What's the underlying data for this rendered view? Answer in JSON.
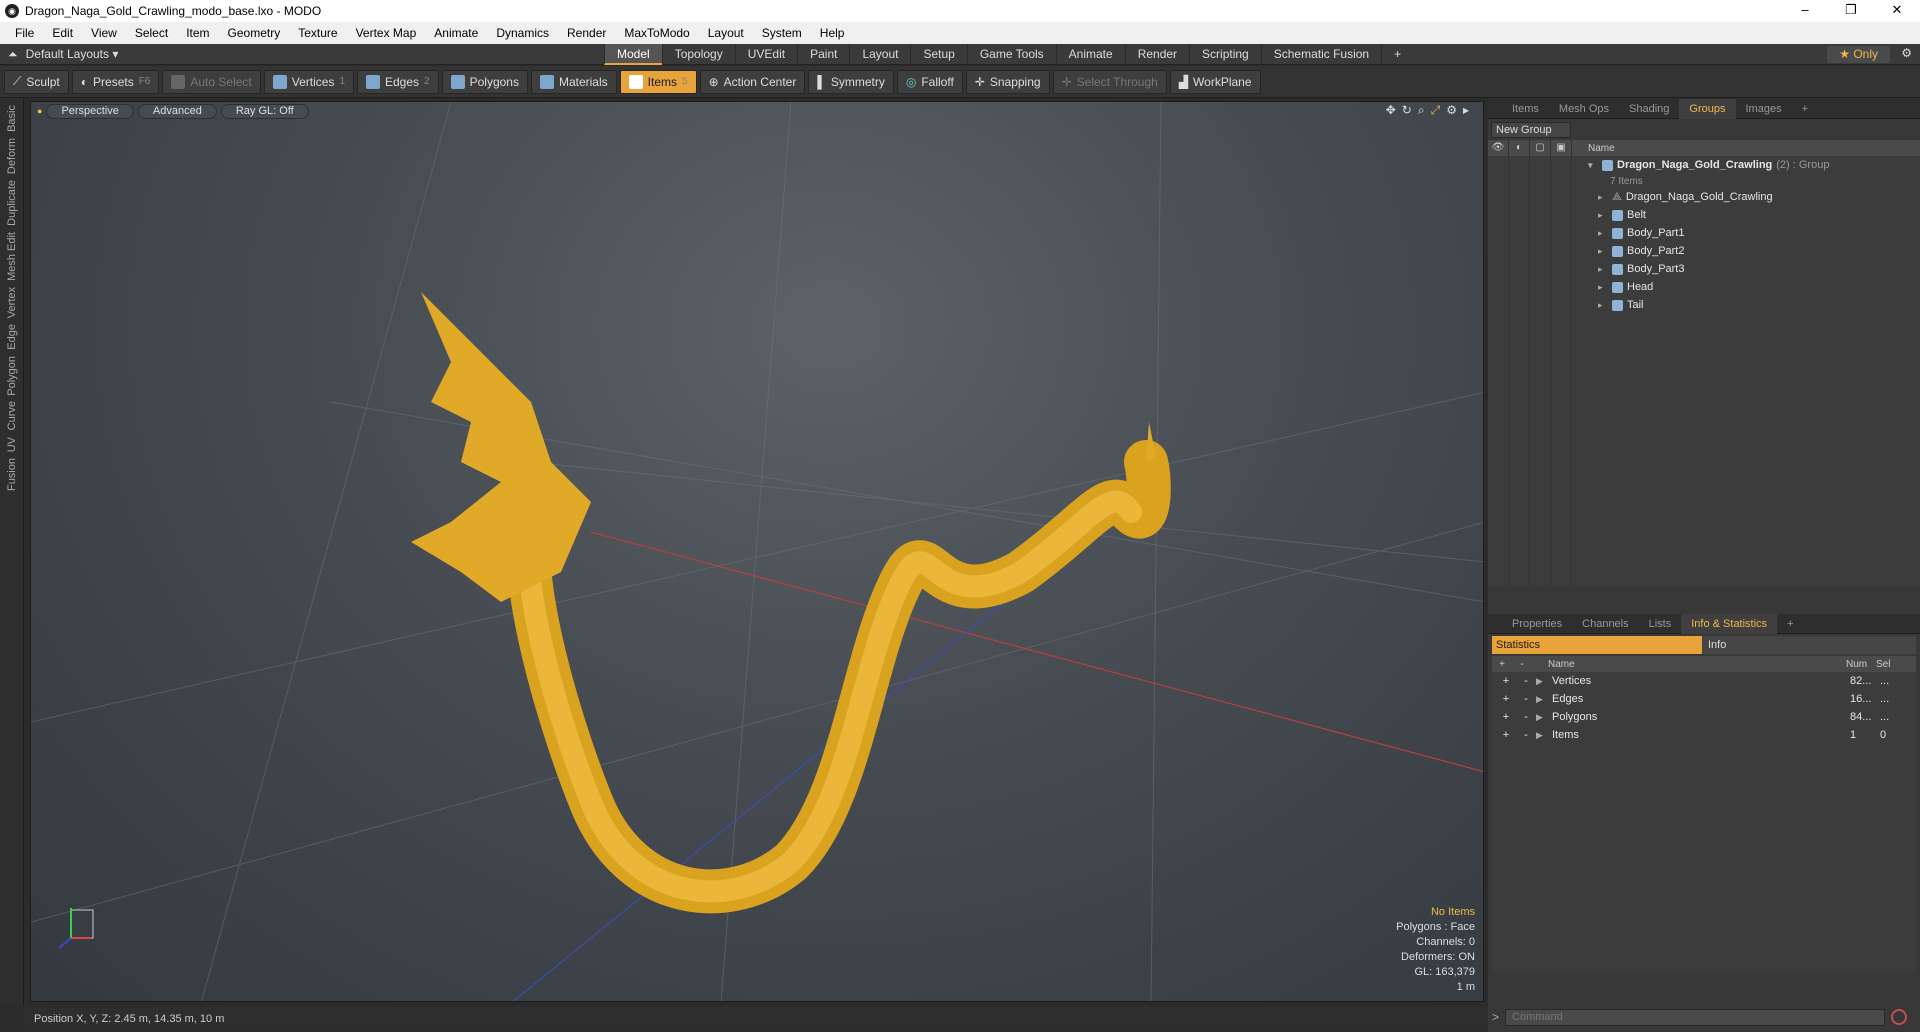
{
  "window": {
    "title": "Dragon_Naga_Gold_Crawling_modo_base.lxo - MODO",
    "min": "–",
    "max": "❐",
    "close": "✕"
  },
  "menu": [
    "File",
    "Edit",
    "View",
    "Select",
    "Item",
    "Geometry",
    "Texture",
    "Vertex Map",
    "Animate",
    "Dynamics",
    "Render",
    "MaxToModo",
    "Layout",
    "System",
    "Help"
  ],
  "layout": {
    "name": "Default Layouts",
    "tabs": [
      "Model",
      "Topology",
      "UVEdit",
      "Paint",
      "Layout",
      "Setup",
      "Game Tools",
      "Animate",
      "Render",
      "Scripting",
      "Schematic Fusion"
    ],
    "active_tab": "Model",
    "add": "+",
    "only": "Only"
  },
  "toolbar": {
    "sculpt": "Sculpt",
    "presets": "Presets",
    "presets_key": "F6",
    "auto_select": "Auto Select",
    "vertices": "Vertices",
    "vertices_key": "1",
    "edges": "Edges",
    "edges_key": "2",
    "polygons": "Polygons",
    "materials": "Materials",
    "items": "Items",
    "items_key": "5",
    "action_center": "Action Center",
    "symmetry": "Symmetry",
    "falloff": "Falloff",
    "snapping": "Snapping",
    "select_through": "Select Through",
    "workplane": "WorkPlane"
  },
  "left_strip": [
    "Basic",
    "Deform",
    "Duplicate",
    "Mesh Edit",
    "Vertex",
    "Edge",
    "Polygon",
    "Curve",
    "UV",
    "Fusion"
  ],
  "viewport": {
    "view": "Perspective",
    "mode": "Advanced",
    "raygl": "Ray GL: Off",
    "info": {
      "no_items": "No Items",
      "polygons": "Polygons : Face",
      "channels": "Channels: 0",
      "deformers": "Deformers: ON",
      "gl": "GL: 163,379",
      "scale": "1 m"
    }
  },
  "status": {
    "position": "Position X, Y, Z:  2.45 m, 14.35 m, 10 m"
  },
  "groups_panel": {
    "tabs": [
      "Items",
      "Mesh Ops",
      "Shading",
      "Groups",
      "Images"
    ],
    "active": "Groups",
    "new_group": "New Group",
    "col_name": "Name",
    "group_name": "Dragon_Naga_Gold_Crawling",
    "group_suffix": "(2) : Group",
    "group_count": "7 Items",
    "items": [
      "Dragon_Naga_Gold_Crawling",
      "Belt",
      "Body_Part1",
      "Body_Part2",
      "Body_Part3",
      "Head",
      "Tail"
    ]
  },
  "stats_panel": {
    "tabs": [
      "Properties",
      "Channels",
      "Lists",
      "Info & Statistics"
    ],
    "active": "Info & Statistics",
    "sub_statistics": "Statistics",
    "sub_info": "Info",
    "col_name": "Name",
    "col_num": "Num",
    "col_sel": "Sel",
    "rows": [
      {
        "name": "Vertices",
        "num": "82...",
        "sel": "..."
      },
      {
        "name": "Edges",
        "num": "16...",
        "sel": "..."
      },
      {
        "name": "Polygons",
        "num": "84...",
        "sel": "..."
      },
      {
        "name": "Items",
        "num": "1",
        "sel": "0"
      }
    ]
  },
  "command": {
    "placeholder": "Command"
  },
  "colors": {
    "accent": "#e8a33a",
    "gold": "#e8b333",
    "viewport_bg": "#454b51"
  }
}
